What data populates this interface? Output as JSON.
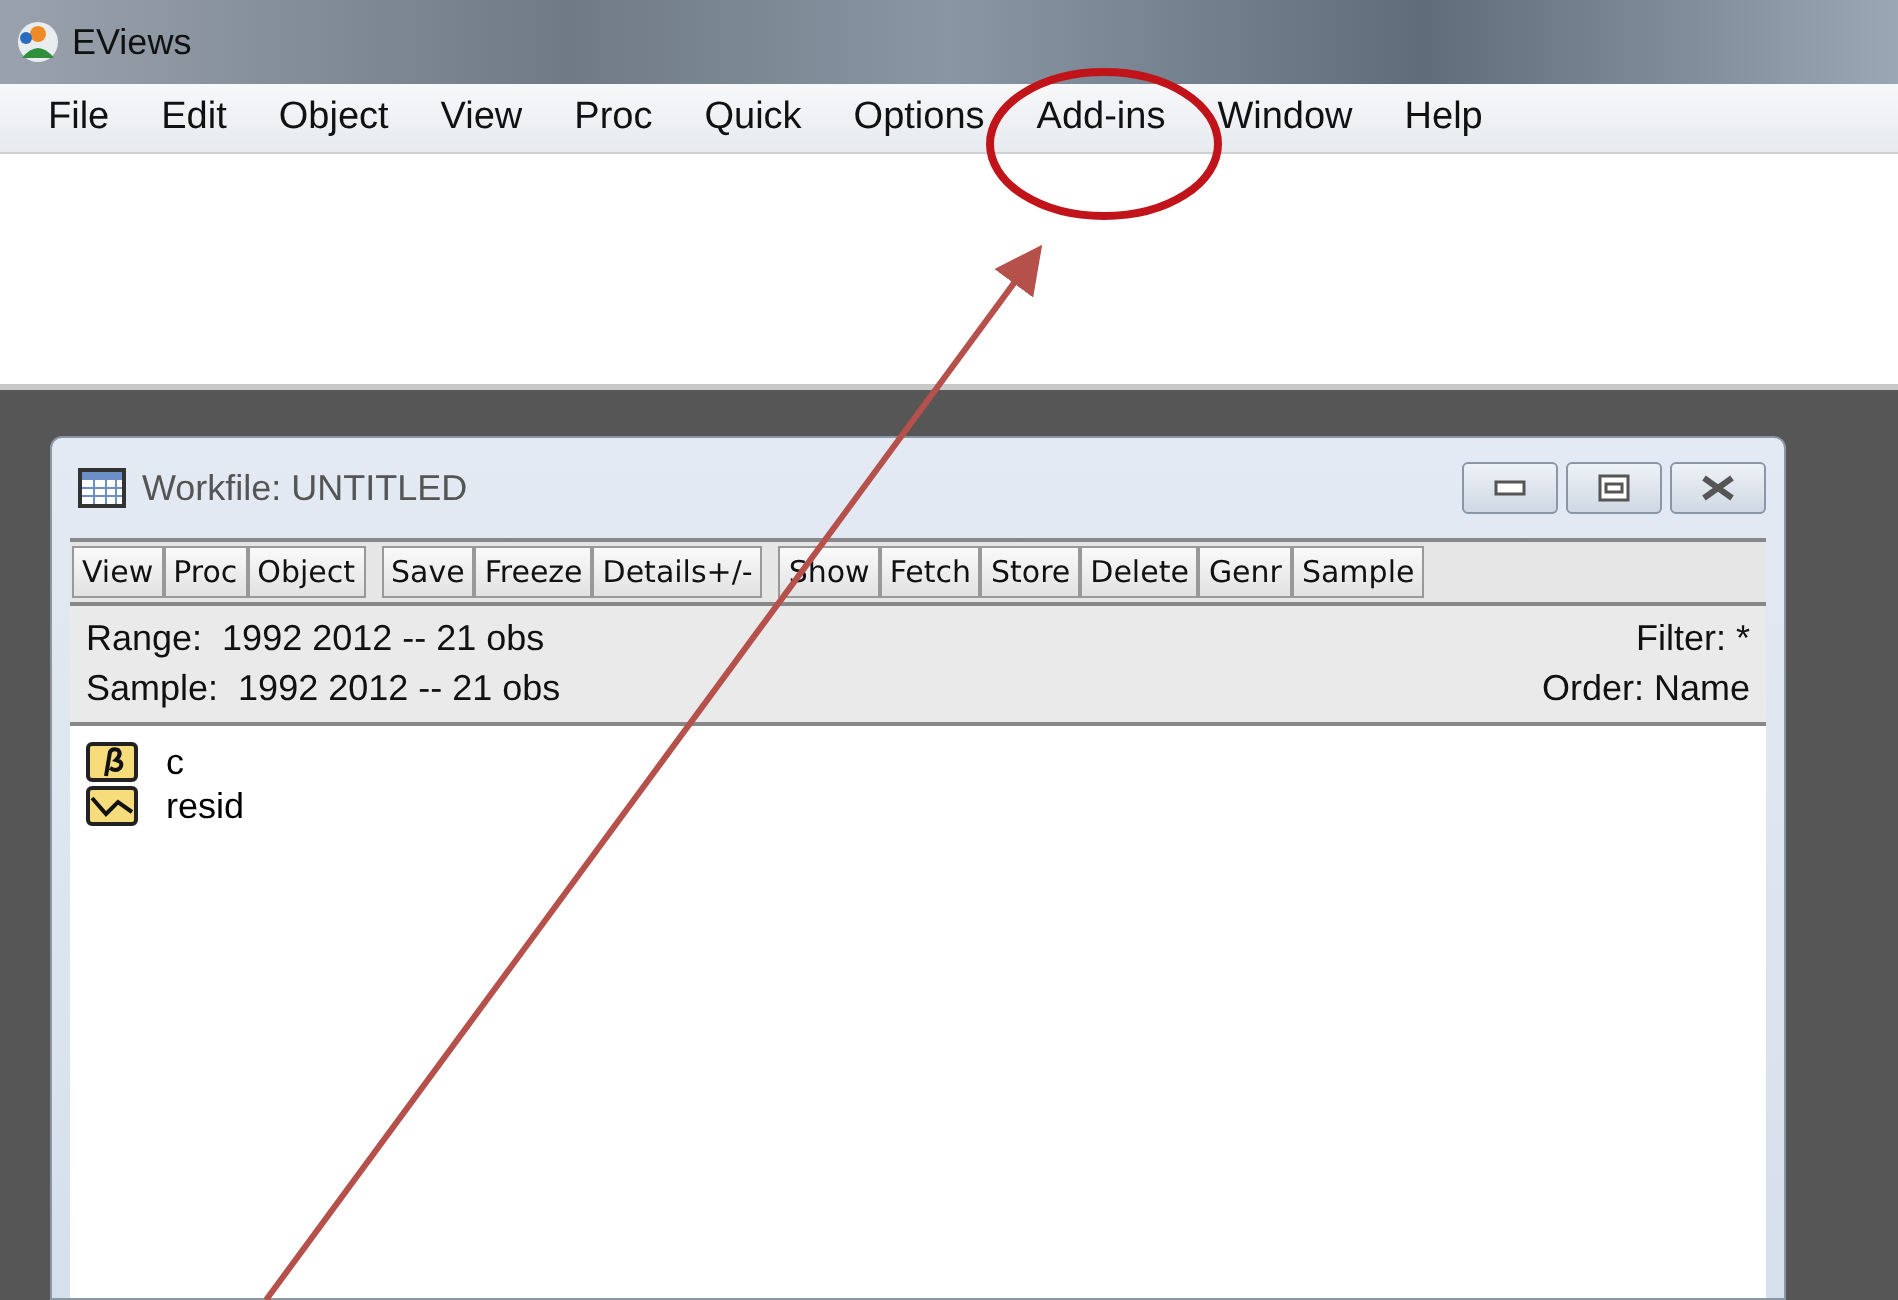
{
  "window": {
    "title": "EViews"
  },
  "menu": [
    "File",
    "Edit",
    "Object",
    "View",
    "Proc",
    "Quick",
    "Options",
    "Add-ins",
    "Window",
    "Help"
  ],
  "workfile": {
    "title": "Workfile: UNTITLED",
    "toolbar_groups": [
      [
        "View",
        "Proc",
        "Object"
      ],
      [
        "Save",
        "Freeze",
        "Details+/-"
      ],
      [
        "Show",
        "Fetch",
        "Store",
        "Delete",
        "Genr",
        "Sample"
      ]
    ],
    "info": [
      {
        "label": "Range:",
        "value": "1992 2012  --  21 obs",
        "right": "Filter: *"
      },
      {
        "label": "Sample:",
        "value": "1992 2012  --  21 obs",
        "right": "Order: Name"
      }
    ],
    "objects": [
      {
        "kind": "coef",
        "name": "c"
      },
      {
        "kind": "series",
        "name": "resid"
      }
    ]
  }
}
